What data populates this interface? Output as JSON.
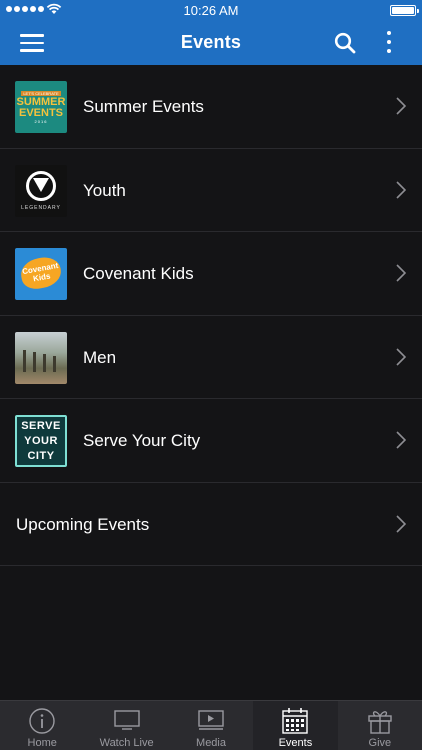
{
  "status_bar": {
    "time": "10:26 AM"
  },
  "header": {
    "title": "Events",
    "color": "#1f6fc2",
    "menu_icon": "hamburger-menu-icon",
    "search_icon": "search-icon",
    "more_icon": "vertical-ellipsis-icon"
  },
  "list": {
    "items": [
      {
        "label": "Summer Events",
        "thumb": "summer-events-thumbnail",
        "thumb_text": {
          "tag": "LET'S CELEBRATE",
          "line1": "SUMMER",
          "line2": "EVENTS",
          "year": "2016"
        }
      },
      {
        "label": "Youth",
        "thumb": "legendary-youth-thumbnail",
        "thumb_text": {
          "word": "LEGENDARY"
        }
      },
      {
        "label": "Covenant Kids",
        "thumb": "covenant-kids-thumbnail",
        "thumb_text": {
          "line1": "Covenant",
          "line2": "Kids"
        }
      },
      {
        "label": "Men",
        "thumb": "men-trees-thumbnail"
      },
      {
        "label": "Serve Your City",
        "thumb": "serve-your-city-thumbnail",
        "thumb_text": {
          "line1": "SERVE",
          "line2": "YOUR",
          "line3": "CITY"
        }
      },
      {
        "label": "Upcoming Events"
      }
    ]
  },
  "tab_bar": {
    "tabs": [
      {
        "label": "Home",
        "icon": "info-circle-icon"
      },
      {
        "label": "Watch Live",
        "icon": "tv-icon"
      },
      {
        "label": "Media",
        "icon": "play-screen-icon"
      },
      {
        "label": "Events",
        "icon": "calendar-icon",
        "active": true
      },
      {
        "label": "Give",
        "icon": "gift-icon"
      }
    ]
  }
}
